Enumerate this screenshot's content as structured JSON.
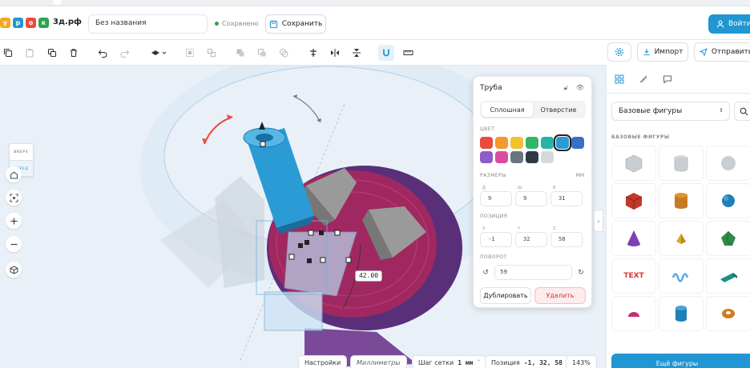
{
  "header": {
    "logo_letters": [
      "у",
      "р",
      "о",
      "к"
    ],
    "logo_colors": [
      "#f4a81d",
      "#2196d3",
      "#e94b3c",
      "#2ea44f"
    ],
    "logo_text": "3д.рф",
    "title_value": "Без названия",
    "saved_status": "Сохранено",
    "save_label": "Сохранить",
    "login_label": "Войти"
  },
  "toolbar": {
    "icons": [
      "copy-icon",
      "paste-icon",
      "duplicate-icon",
      "delete-icon",
      "undo-icon",
      "redo-icon",
      "workplane-icon",
      "group-icon",
      "ungroup-icon",
      "solid-icon",
      "hole-icon",
      "combine-icon",
      "align-icon",
      "mirror-icon",
      "flip-icon",
      "magnet-icon",
      "ruler-icon"
    ],
    "import_label": "Импорт",
    "send_label": "Отправить"
  },
  "viewcube": {
    "top_label": "ВВЕРХ",
    "front_label": "ПЕРЕД"
  },
  "navigation": [
    "home-icon",
    "fit-view-icon",
    "zoom-in-icon",
    "zoom-out-icon",
    "perspective-icon"
  ],
  "measure_label": "42.00",
  "inspector": {
    "title": "Труба",
    "mode_solid": "Сплошная",
    "mode_hole": "Отверстие",
    "color_label": "ЦВЕТ",
    "colors": [
      "#e94b3c",
      "#f29a2e",
      "#f2c12e",
      "#34b46a",
      "#26b5a3",
      "#2b9bd6",
      "#3b6fc6",
      "#8e5bc9",
      "#d94da1",
      "#6b7580",
      "#2f3a45",
      "#d5d9de"
    ],
    "selected_color": "#2b9bd6",
    "dims_label": "РАЗМЕРЫ",
    "dims_unit": "ММ",
    "dims": [
      {
        "label": "Д",
        "value": "9"
      },
      {
        "label": "Ш",
        "value": "9"
      },
      {
        "label": "В",
        "value": "31"
      }
    ],
    "pos_label": "ПОЗИЦИЯ",
    "pos": [
      {
        "label": "X",
        "value": "-1"
      },
      {
        "label": "Y",
        "value": "32"
      },
      {
        "label": "Z",
        "value": "58"
      }
    ],
    "rot_label": "ПОВОРОТ",
    "rot_value": "59",
    "duplicate_label": "Дублировать",
    "delete_label": "Удалить"
  },
  "statusbar": {
    "settings_label": "Настройки",
    "units_label": "Миллиметры",
    "grid_label": "Шаг сетки",
    "grid_value": "1 мм",
    "position_label": "Позиция",
    "position_value": "-1, 32, 58",
    "zoom_value": "143%"
  },
  "sidebar": {
    "tabs": [
      "shapes-icon",
      "ruler-tab-icon",
      "comments-icon"
    ],
    "category": "Базовые фигуры",
    "section_title": "БАЗОВЫЕ ФИГУРЫ",
    "text_shape_label": "TEXT",
    "shapes": [
      "box-hole",
      "cylinder-hole",
      "sphere-hole",
      "box",
      "cylinder",
      "sphere",
      "cone",
      "pyramid",
      "polyhedron",
      "text",
      "squiggle",
      "wedge",
      "half-sphere",
      "tube-cylinder",
      "torus"
    ],
    "more_label": "Ещё фигуры"
  }
}
